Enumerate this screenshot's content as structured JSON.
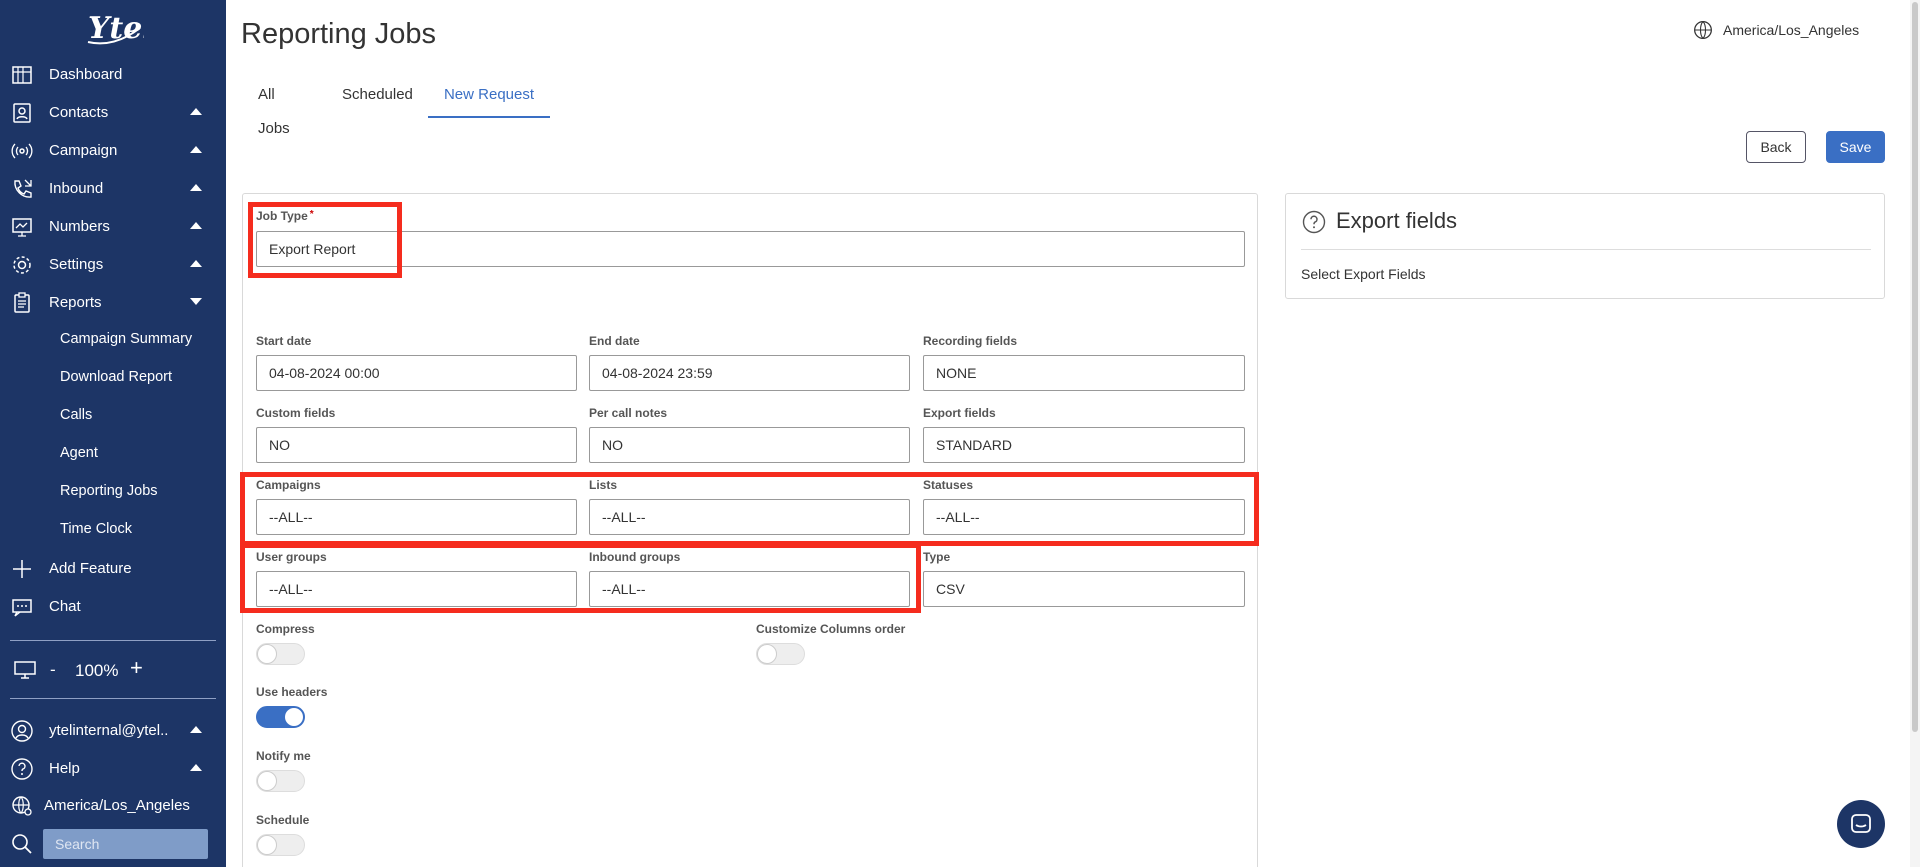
{
  "app": {
    "logo_text": "Ytel"
  },
  "sidebar": {
    "items": [
      {
        "label": "Dashboard",
        "icon": "dashboard-icon",
        "caret": "none"
      },
      {
        "label": "Contacts",
        "icon": "contacts-icon",
        "caret": "up"
      },
      {
        "label": "Campaign",
        "icon": "campaign-icon",
        "caret": "up"
      },
      {
        "label": "Inbound",
        "icon": "phone-icon",
        "caret": "up"
      },
      {
        "label": "Numbers",
        "icon": "numbers-icon",
        "caret": "up"
      },
      {
        "label": "Settings",
        "icon": "gear-icon",
        "caret": "up"
      },
      {
        "label": "Reports",
        "icon": "clipboard-icon",
        "caret": "down"
      }
    ],
    "sub_items": [
      "Campaign Summary",
      "Download Report",
      "Calls",
      "Agent",
      "Reporting Jobs",
      "Time Clock"
    ],
    "add_feature": "Add Feature",
    "chat": "Chat",
    "zoom": {
      "minus": "-",
      "value": "100%",
      "plus": "+"
    },
    "user": "ytelinternal@ytel..",
    "help": "Help",
    "timezone": "America/Los_Angeles",
    "search_placeholder": "Search"
  },
  "header": {
    "title": "Reporting Jobs",
    "timezone": "America/Los_Angeles",
    "tabs": [
      "All Jobs",
      "Scheduled",
      "New Request"
    ],
    "active_tab": "New Request",
    "back_label": "Back",
    "save_label": "Save"
  },
  "form": {
    "job_type": {
      "label": "Job Type",
      "required": "*",
      "value": "Export Report"
    },
    "start_date": {
      "label": "Start date",
      "value": "04-08-2024 00:00"
    },
    "end_date": {
      "label": "End date",
      "value": "04-08-2024 23:59"
    },
    "recording_fields": {
      "label": "Recording fields",
      "value": "NONE"
    },
    "custom_fields": {
      "label": "Custom fields",
      "value": "NO"
    },
    "per_call_notes": {
      "label": "Per call notes",
      "value": "NO"
    },
    "export_fields": {
      "label": "Export fields",
      "value": "STANDARD"
    },
    "campaigns": {
      "label": "Campaigns",
      "value": "--ALL--"
    },
    "lists": {
      "label": "Lists",
      "value": "--ALL--"
    },
    "statuses": {
      "label": "Statuses",
      "value": "--ALL--"
    },
    "user_groups": {
      "label": "User groups",
      "value": "--ALL--"
    },
    "inbound_groups": {
      "label": "Inbound groups",
      "value": "--ALL--"
    },
    "type": {
      "label": "Type",
      "value": "CSV"
    },
    "compress": {
      "label": "Compress",
      "on": false
    },
    "customize_columns": {
      "label": "Customize Columns order",
      "on": false
    },
    "use_headers": {
      "label": "Use headers",
      "on": true
    },
    "notify_me": {
      "label": "Notify me",
      "on": false
    },
    "schedule": {
      "label": "Schedule",
      "on": false
    }
  },
  "export_panel": {
    "title": "Export fields",
    "subtitle": "Select Export Fields"
  },
  "colors": {
    "sidebar": "#1d3566",
    "accent": "#3a6fc4",
    "highlight": "#f52c1e"
  }
}
